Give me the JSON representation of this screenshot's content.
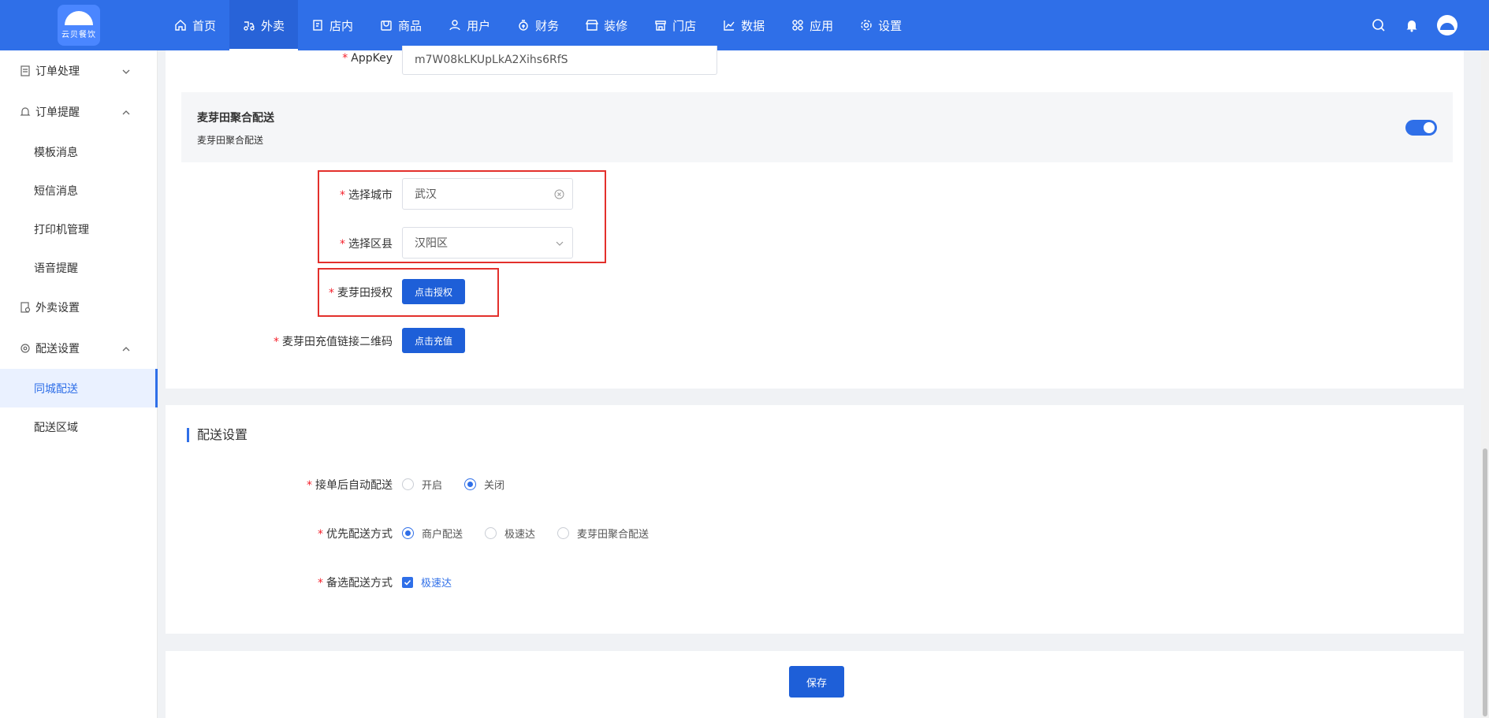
{
  "header": {
    "logo_text": "云贝餐饮",
    "nav": [
      {
        "label": "首页",
        "icon": "home-icon"
      },
      {
        "label": "外卖",
        "icon": "delivery-icon"
      },
      {
        "label": "店内",
        "icon": "store-inside-icon"
      },
      {
        "label": "商品",
        "icon": "product-icon"
      },
      {
        "label": "用户",
        "icon": "user-icon"
      },
      {
        "label": "财务",
        "icon": "finance-icon"
      },
      {
        "label": "装修",
        "icon": "decoration-icon"
      },
      {
        "label": "门店",
        "icon": "shop-icon"
      },
      {
        "label": "数据",
        "icon": "chart-icon"
      },
      {
        "label": "应用",
        "icon": "apps-icon"
      },
      {
        "label": "设置",
        "icon": "gear-icon"
      }
    ],
    "active_nav": "外卖"
  },
  "sidebar": {
    "groups": [
      {
        "label": "订单处理",
        "icon": "document-icon",
        "expanded": false
      },
      {
        "label": "订单提醒",
        "icon": "bell-icon",
        "expanded": true,
        "items": [
          "模板消息",
          "短信消息",
          "打印机管理",
          "语音提醒"
        ]
      },
      {
        "label": "外卖设置",
        "icon": "settings-doc-icon"
      },
      {
        "label": "配送设置",
        "icon": "delivery-settings-icon",
        "expanded": true,
        "items": [
          "同城配送",
          "配送区域"
        ]
      }
    ],
    "active_item": "同城配送"
  },
  "form": {
    "appkey_label": "AppKey",
    "appkey_value": "m7W08kLKUpLkA2Xihs6RfS",
    "banner_title": "麦芽田聚合配送",
    "banner_sub": "麦芽田聚合配送",
    "banner_toggle_on": true,
    "city_label": "选择城市",
    "city_value": "武汉",
    "district_label": "选择区县",
    "district_value": "汉阳区",
    "auth_label": "麦芽田授权",
    "auth_button": "点击授权",
    "recharge_label": "麦芽田充值链接二维码",
    "recharge_button": "点击充值"
  },
  "delivery_settings": {
    "title": "配送设置",
    "auto_label": "接单后自动配送",
    "auto_options": [
      "开启",
      "关闭"
    ],
    "auto_selected": "关闭",
    "priority_label": "优先配送方式",
    "priority_options": [
      "商户配送",
      "极速达",
      "麦芽田聚合配送"
    ],
    "priority_selected": "商户配送",
    "backup_label": "备选配送方式",
    "backup_option": "极速达",
    "backup_checked": true
  },
  "footer": {
    "save_button": "保存"
  },
  "colors": {
    "primary": "#2f6fe8",
    "button": "#1e5fd8",
    "highlight_box": "#e3302c",
    "required": "#f5222d"
  }
}
